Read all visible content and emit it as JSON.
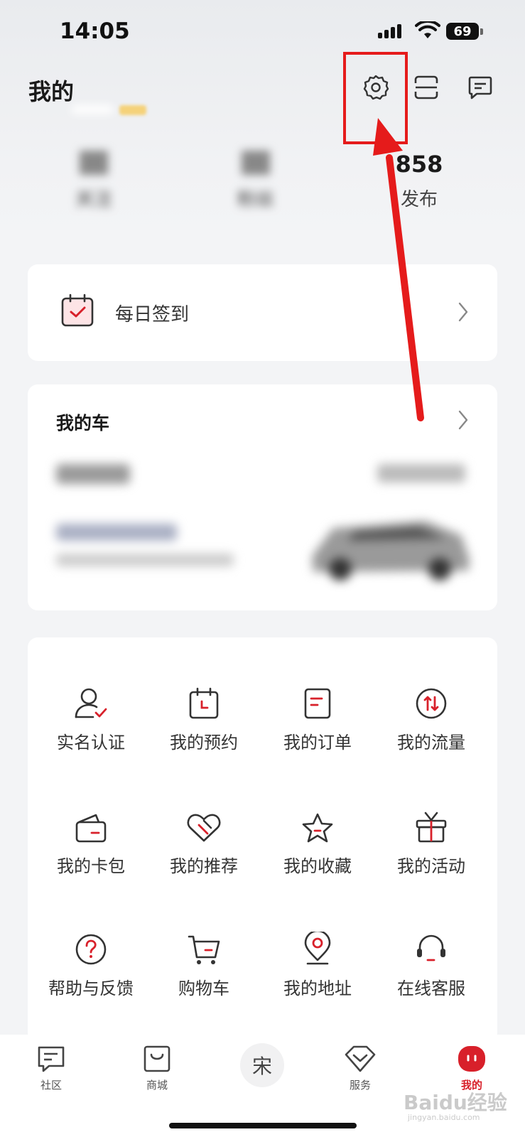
{
  "status_bar": {
    "time": "14:05",
    "battery": "69"
  },
  "header": {
    "title": "我的"
  },
  "profile_stats": [
    {
      "label": "关注"
    },
    {
      "label": "粉丝"
    },
    {
      "count": "858",
      "label": "发布"
    }
  ],
  "checkin": {
    "label": "每日签到"
  },
  "my_car": {
    "title": "我的车"
  },
  "services": [
    {
      "label": "实名认证",
      "icon": "user-check-icon"
    },
    {
      "label": "我的预约",
      "icon": "calendar-icon"
    },
    {
      "label": "我的订单",
      "icon": "order-icon"
    },
    {
      "label": "我的流量",
      "icon": "data-flow-icon"
    },
    {
      "label": "我的卡包",
      "icon": "wallet-icon"
    },
    {
      "label": "我的推荐",
      "icon": "recommend-icon"
    },
    {
      "label": "我的收藏",
      "icon": "star-icon"
    },
    {
      "label": "我的活动",
      "icon": "gift-icon"
    },
    {
      "label": "帮助与反馈",
      "icon": "help-icon"
    },
    {
      "label": "购物车",
      "icon": "cart-icon"
    },
    {
      "label": "我的地址",
      "icon": "location-icon"
    },
    {
      "label": "在线客服",
      "icon": "headset-icon"
    }
  ],
  "tabbar": {
    "tabs": [
      {
        "label": "社区"
      },
      {
        "label": "商城"
      },
      {
        "label": "宋"
      },
      {
        "label": "服务"
      },
      {
        "label": "我的"
      }
    ],
    "active": "我的"
  },
  "watermark": {
    "text": "Baidu经验",
    "sub": "jingyan.baidu.com"
  },
  "colors": {
    "accent": "#d8202a",
    "annotation": "#e51b1b"
  }
}
